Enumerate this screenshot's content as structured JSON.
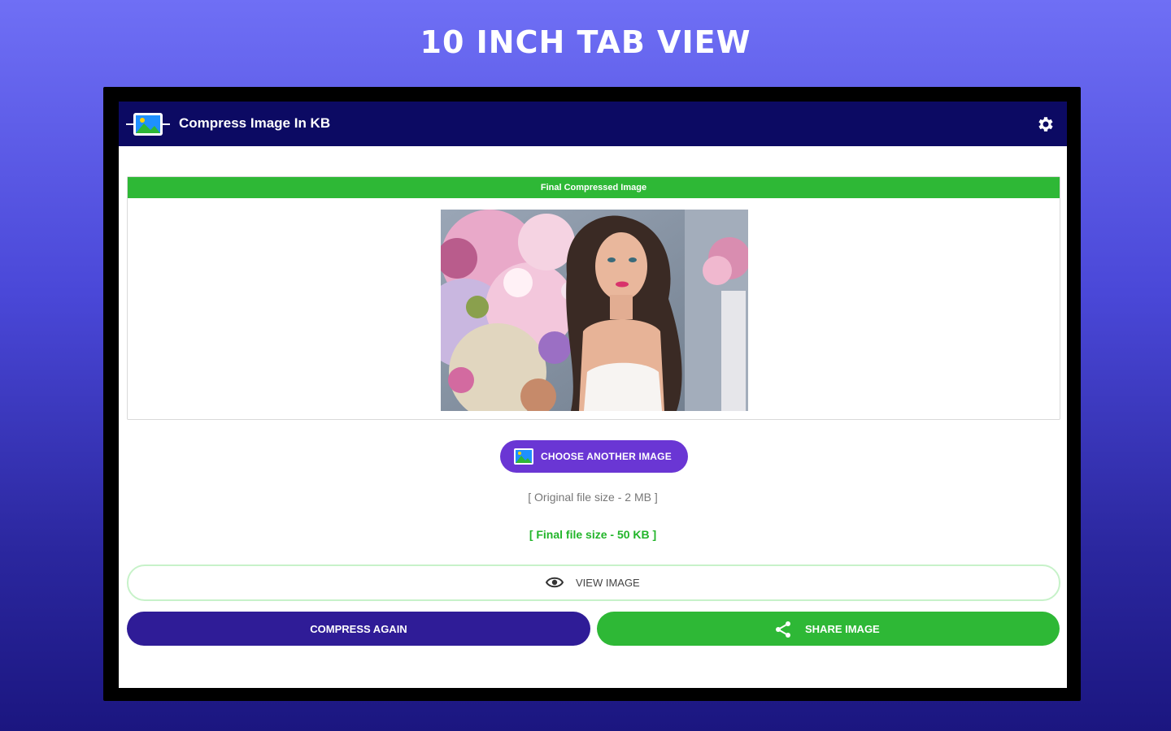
{
  "promo": {
    "title": "10 INCH TAB VIEW"
  },
  "appbar": {
    "title": "Compress Image In KB",
    "app_icon": "image-compress-icon",
    "settings_icon": "gear-icon"
  },
  "result_card": {
    "header": "Final Compressed Image"
  },
  "buttons": {
    "choose_another": "CHOOSE ANOTHER IMAGE",
    "view_image": "VIEW IMAGE",
    "compress_again": "COMPRESS AGAIN",
    "share_image": "SHARE IMAGE"
  },
  "sizes": {
    "original": "[ Original file size - 2 MB ]",
    "final": "[ Final file size - 50 KB ]"
  },
  "colors": {
    "appbar": "#0c0a63",
    "green": "#2eb836",
    "purple": "#6a36d4",
    "indigo": "#2f1c97"
  }
}
